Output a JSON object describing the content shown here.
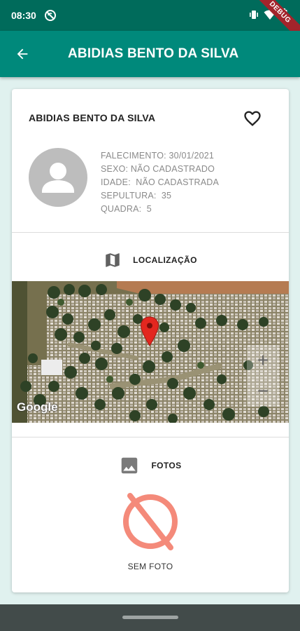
{
  "status_bar": {
    "time": "08:30",
    "debug_banner": "DEBUG",
    "left_icon": "sync-disabled-icon",
    "right_icons": [
      "vibrate-icon",
      "wifi-icon",
      "battery-icon"
    ]
  },
  "app_bar": {
    "title": "ABIDIAS BENTO DA SILVA",
    "back_icon": "arrow-back-icon",
    "color": "#00897b"
  },
  "person": {
    "name": "ABIDIAS BENTO DA SILVA",
    "favorite_icon": "heart-outline-icon",
    "avatar_icon": "person-icon",
    "details": [
      "FALECIMENTO: 30/01/2021",
      "SEXO: NÃO CADASTRADO",
      "IDADE:  NÃO CADASTRADA",
      "SEPULTURA:  35",
      "QUADRA:  5"
    ]
  },
  "location": {
    "label": "LOCALIZAÇÃO",
    "icon": "map-icon",
    "map": {
      "attribution": "Google",
      "zoom_in_label": "+",
      "zoom_out_label": "−",
      "marker_icon": "map-pin-icon"
    }
  },
  "photos": {
    "label": "FOTOS",
    "icon": "image-icon",
    "empty_icon": "no-photo-icon",
    "empty_label": "SEM FOTO",
    "accent": "#f48a7a"
  },
  "colors": {
    "status_bar": "#006b5b",
    "background": "#e0f1ef",
    "debug_ribbon": "#a3242b"
  }
}
